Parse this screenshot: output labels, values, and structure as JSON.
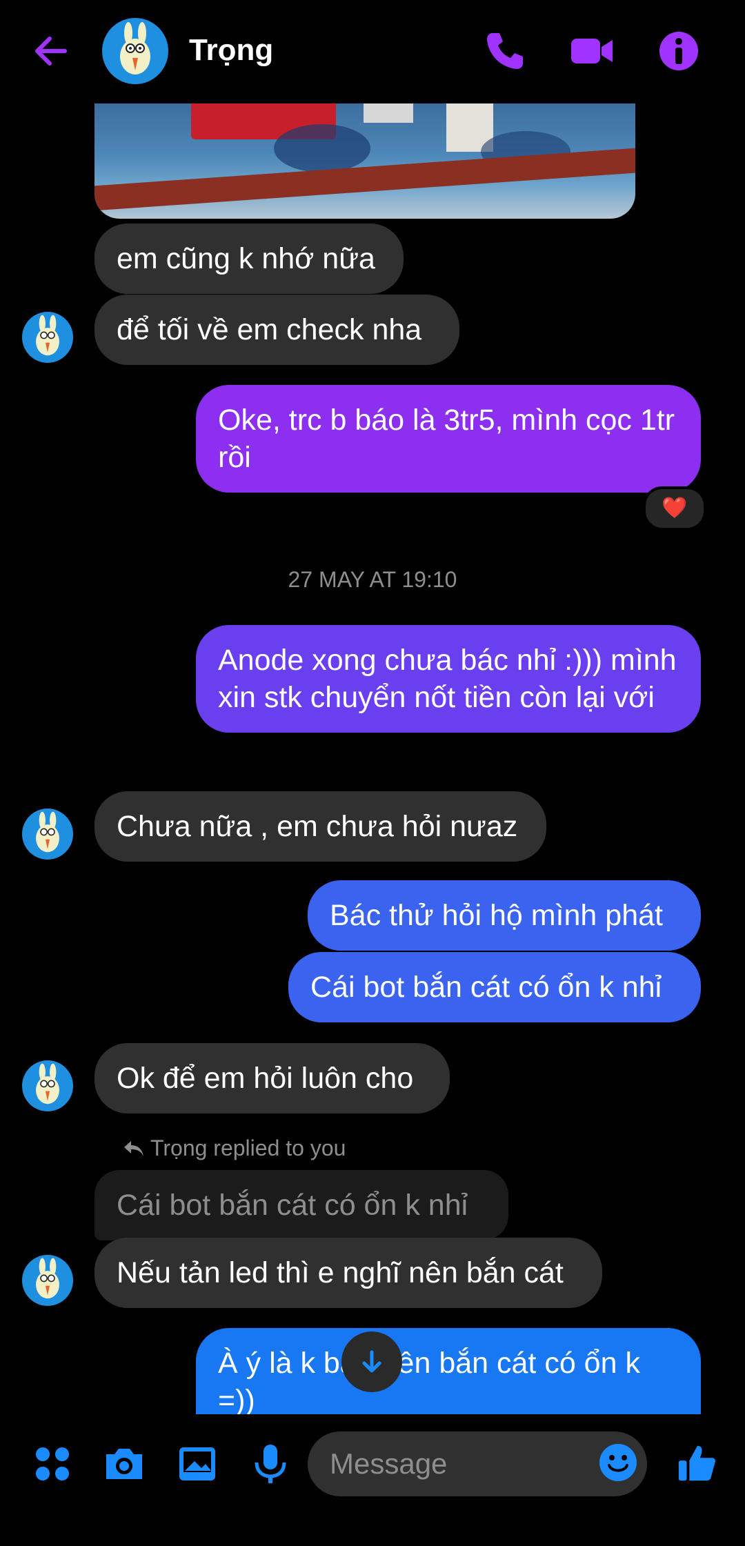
{
  "header": {
    "contact_name": "Trọng"
  },
  "messages": [
    {
      "from": "them",
      "text": "em cũng k nhớ nữa"
    },
    {
      "from": "them",
      "text": "để tối về em check nha"
    },
    {
      "from": "me",
      "text": "Oke, trc b báo là 3tr5, mình cọc 1tr rồi",
      "reaction": "❤️"
    },
    {
      "timestamp": "27 MAY AT 19:10"
    },
    {
      "from": "me",
      "text": "Anode xong chưa bác nhỉ :))) mình xin stk chuyển nốt tiền còn lại với"
    },
    {
      "from": "them",
      "text": "Chưa nữa , em chưa hỏi nưaz"
    },
    {
      "from": "me",
      "text": "Bác thử hỏi hộ mình phát"
    },
    {
      "from": "me",
      "text": "Cái bot bắn cát có ổn k nhỉ"
    },
    {
      "from": "them",
      "text": "Ok để em hỏi luôn cho"
    },
    {
      "reply_label": "Trọng replied to you",
      "quoted": "Cái bot bắn cát có ổn k nhỉ"
    },
    {
      "from": "them",
      "text": "Nếu tản led thì e nghĩ nên bắn cát"
    },
    {
      "from": "me",
      "text": "À ý là k bắn bên bắn cát có ổn k =))"
    }
  ],
  "composer": {
    "placeholder": "Message"
  },
  "colors": {
    "accent": "#a033ff",
    "outgoing_blue": "#1877f2",
    "incoming": "#303030"
  }
}
